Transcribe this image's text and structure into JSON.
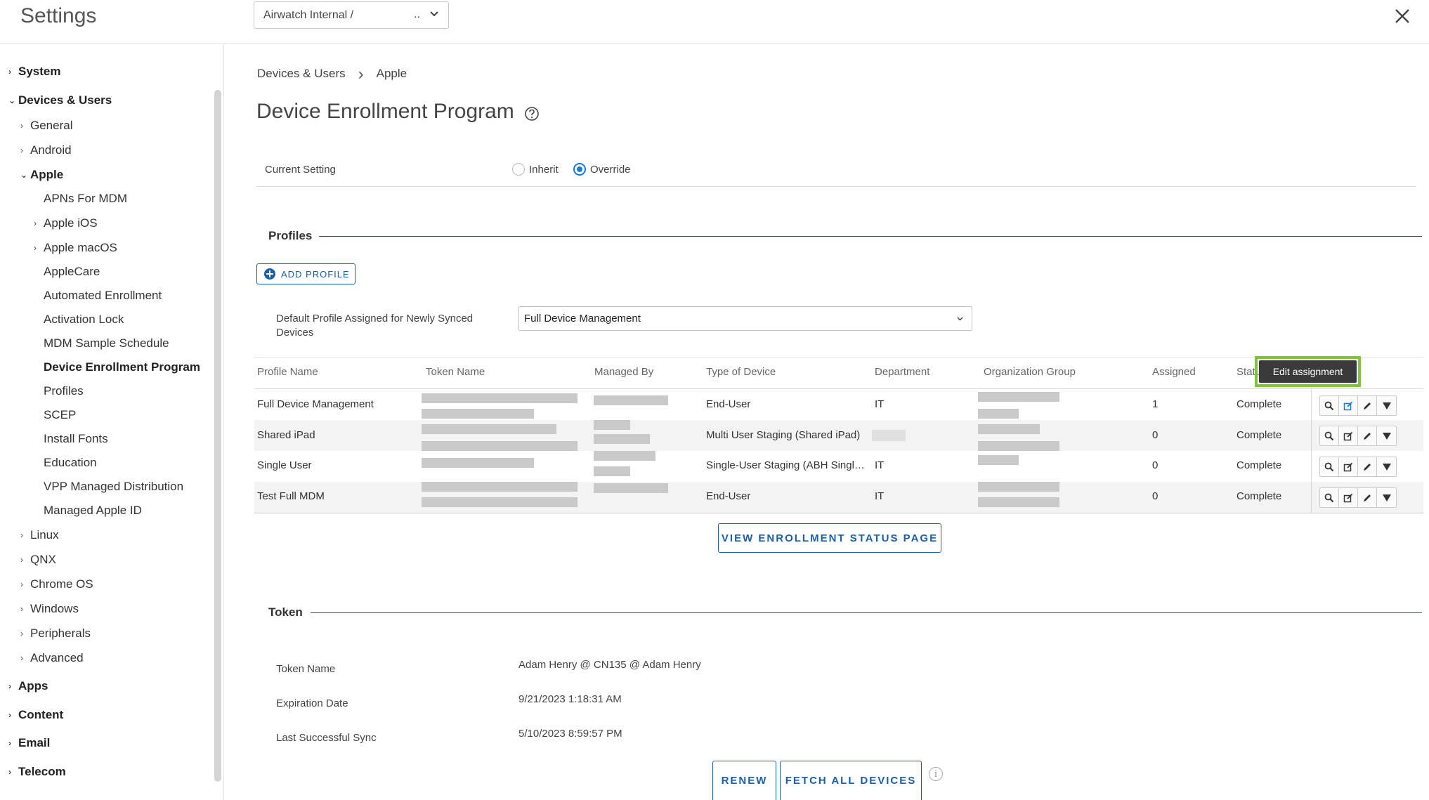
{
  "app": {
    "title": "Settings"
  },
  "org_selector": {
    "value": "Airwatch Internal /",
    "ellipsis": ".."
  },
  "sidebar": {
    "items": [
      {
        "label": "System",
        "caret": "›",
        "bold": true
      },
      {
        "label": "Devices & Users",
        "caret": "⌄",
        "bold": true
      },
      {
        "label": "General",
        "caret": "›"
      },
      {
        "label": "Android",
        "caret": "›"
      },
      {
        "label": "Apple",
        "caret": "⌄",
        "bold": true
      },
      {
        "label": "APNs For MDM"
      },
      {
        "label": "Apple iOS",
        "caret": "›"
      },
      {
        "label": "Apple macOS",
        "caret": "›"
      },
      {
        "label": "AppleCare"
      },
      {
        "label": "Automated Enrollment"
      },
      {
        "label": "Activation Lock"
      },
      {
        "label": "MDM Sample Schedule"
      },
      {
        "label": "Device Enrollment Program",
        "bold": true,
        "active": true
      },
      {
        "label": "Profiles"
      },
      {
        "label": "SCEP"
      },
      {
        "label": "Install Fonts"
      },
      {
        "label": "Education"
      },
      {
        "label": "VPP Managed Distribution"
      },
      {
        "label": "Managed Apple ID"
      },
      {
        "label": "Linux",
        "caret": "›"
      },
      {
        "label": "QNX",
        "caret": "›"
      },
      {
        "label": "Chrome OS",
        "caret": "›"
      },
      {
        "label": "Windows",
        "caret": "›"
      },
      {
        "label": "Peripherals",
        "caret": "›"
      },
      {
        "label": "Advanced",
        "caret": "›"
      },
      {
        "label": "Apps",
        "caret": "›",
        "bold": true
      },
      {
        "label": "Content",
        "caret": "›",
        "bold": true
      },
      {
        "label": "Email",
        "caret": "›",
        "bold": true
      },
      {
        "label": "Telecom",
        "caret": "›",
        "bold": true
      }
    ]
  },
  "breadcrumb": {
    "parent": "Devices & Users",
    "separator": "›",
    "current": "Apple"
  },
  "page": {
    "title": "Device Enrollment Program"
  },
  "current_setting": {
    "label": "Current Setting",
    "options": [
      "Inherit",
      "Override"
    ],
    "selected": "Override"
  },
  "profiles": {
    "section_title": "Profiles",
    "add_button": "ADD PROFILE",
    "default_label_line1": "Default Profile Assigned for Newly Synced",
    "default_label_line2": "Devices",
    "default_value": "Full Device Management",
    "columns": [
      "Profile Name",
      "Token Name",
      "Managed By",
      "Type of Device",
      "Department",
      "Organization Group",
      "Assigned",
      "Status"
    ],
    "rows": [
      {
        "name": "Full Device Management",
        "type": "End-User",
        "department": "IT",
        "assigned": "1",
        "status": "Complete"
      },
      {
        "name": "Shared iPad",
        "type": "Multi User Staging (Shared iPad)",
        "department": "",
        "assigned": "0",
        "status": "Complete"
      },
      {
        "name": "Single User",
        "type": "Single-User Staging (ABH Singl…",
        "department": "IT",
        "assigned": "0",
        "status": "Complete"
      },
      {
        "name": "Test Full MDM",
        "type": "End-User",
        "department": "IT",
        "assigned": "0",
        "status": "Complete"
      }
    ],
    "tooltip": "Edit assignment",
    "status_page_button": "VIEW ENROLLMENT STATUS PAGE"
  },
  "token": {
    "section_title": "Token",
    "fields": [
      {
        "label": "Token Name",
        "value": "Adam Henry @ CN135 @ Adam Henry"
      },
      {
        "label": "Expiration Date",
        "value": "9/21/2023 1:18:31 AM"
      },
      {
        "label": "Last Successful Sync",
        "value": "5/10/2023 8:59:57 PM"
      }
    ],
    "renew_button": "RENEW",
    "fetch_button": "FETCH ALL DEVICES",
    "info_icon": "i"
  },
  "colors": {
    "accent": "#1a5fa8",
    "radio": "#1a7ad4",
    "highlight": "#7dc53a"
  }
}
